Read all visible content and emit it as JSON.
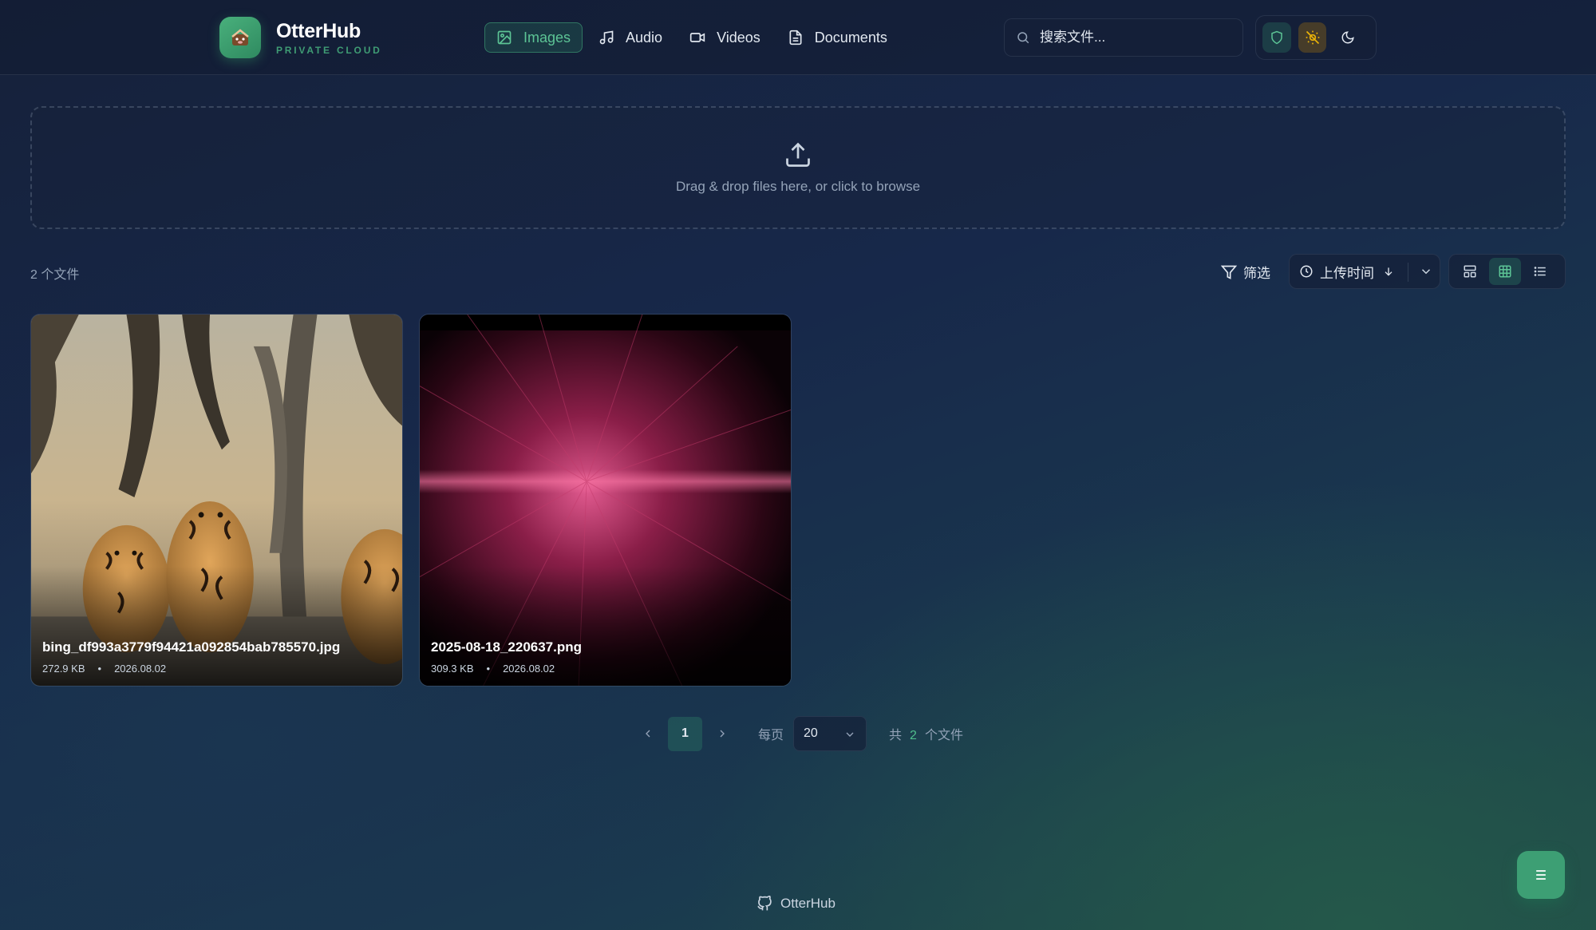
{
  "brand": {
    "title": "OtterHub",
    "subtitle": "PRIVATE CLOUD"
  },
  "nav": [
    {
      "label": "Images",
      "icon": "image-icon",
      "active": true
    },
    {
      "label": "Audio",
      "icon": "music-note-icon"
    },
    {
      "label": "Videos",
      "icon": "video-camera-icon"
    },
    {
      "label": "Documents",
      "icon": "document-icon"
    }
  ],
  "search": {
    "placeholder": "搜索文件..."
  },
  "tools": [
    "shield-icon",
    "sun-off-icon",
    "moon-icon"
  ],
  "dropzone": {
    "text": "Drag & drop files here, or click to browse"
  },
  "toolbar": {
    "count_label": "2 个文件",
    "filter_label": "筛选",
    "sort_label": "上传时间",
    "views": [
      "masonry-view-icon",
      "grid-view-icon",
      "list-view-icon"
    ],
    "active_view": "grid-view-icon"
  },
  "files": [
    {
      "name": "bing_df993a3779f94421a092854bab785570.jpg",
      "size": "272.9 KB",
      "date": "2026.08.02",
      "dot": "•"
    },
    {
      "name": "2025-08-18_220637.png",
      "size": "309.3 KB",
      "date": "2026.08.02",
      "dot": "•"
    }
  ],
  "pagination": {
    "current_page": "1",
    "per_page_label": "每页",
    "per_page_value": "20",
    "total_prefix": "共",
    "total_count": "2",
    "total_suffix": "个文件"
  },
  "footer": {
    "label": "OtterHub"
  },
  "fab": {
    "label": "≡"
  },
  "colors": {
    "accent": "#3d9f74",
    "accent_text": "#5cc495",
    "warning": "#eab308"
  }
}
